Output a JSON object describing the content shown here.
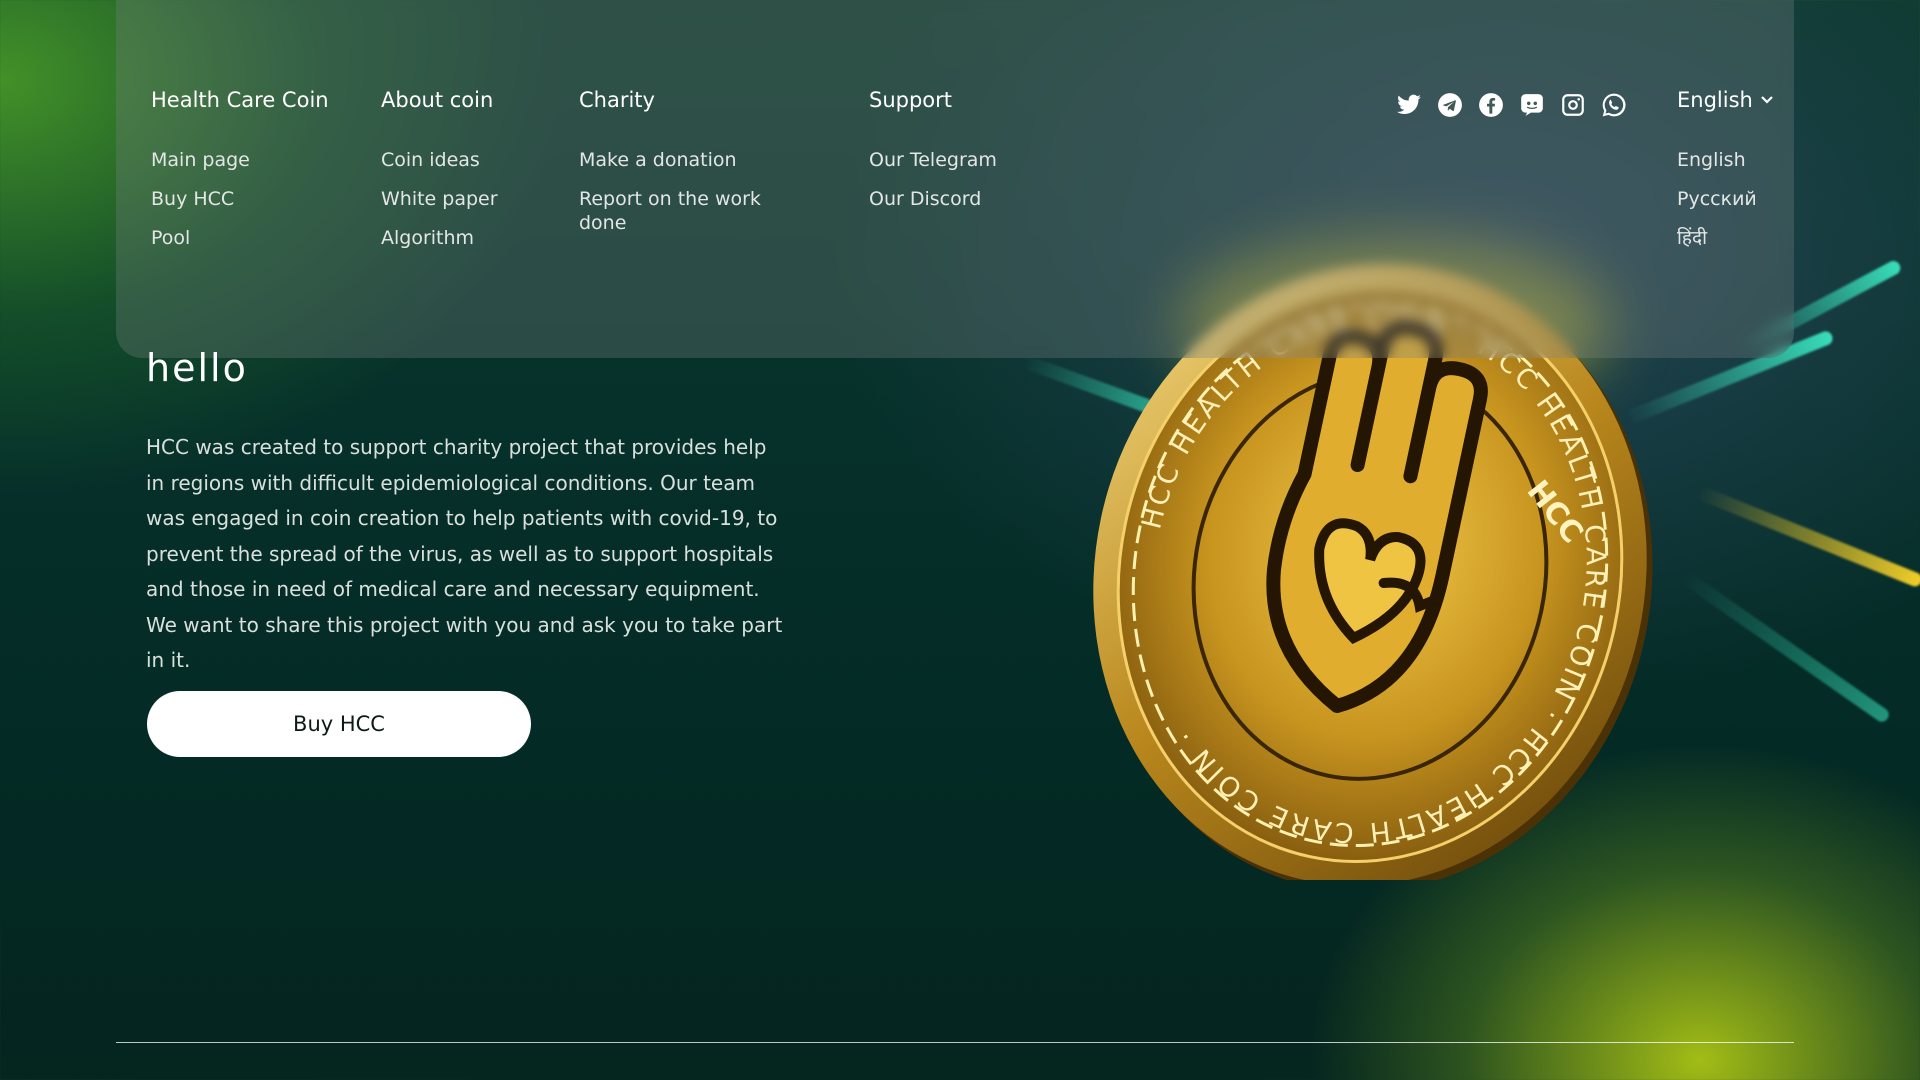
{
  "nav": {
    "columns": [
      {
        "title": "Health Care Coin",
        "links": [
          "Main page",
          "Buy HCC",
          "Pool"
        ]
      },
      {
        "title": "About coin",
        "links": [
          "Coin ideas",
          "White paper",
          "Algorithm"
        ]
      },
      {
        "title": "Charity",
        "links": [
          "Make a donation",
          "Report on the work done"
        ]
      },
      {
        "title": "Support",
        "links": [
          "Our Telegram",
          "Our Discord"
        ]
      }
    ],
    "socials": [
      "twitter-icon",
      "telegram-icon",
      "facebook-icon",
      "discord-icon",
      "instagram-icon",
      "whatsapp-icon"
    ],
    "language": {
      "current": "English",
      "options": [
        "English",
        "Русский",
        "हिंदी"
      ]
    }
  },
  "hero": {
    "heading": "hello",
    "description": "HCC was created to support charity project that provides help in regions with difficult epidemiological conditions. Our team was engaged in coin creation to help patients with covid-19, to prevent the spread of the virus, as well as to support hospitals and those in need of medical care and necessary equipment. We want to share this project with you and ask you to take part in it.",
    "buy_label": "Buy HCC"
  },
  "coin": {
    "ring_text": "HCC HEALTH CARE COIN · HCC HEALTH CARE COIN · HCC HEALTH CARE COIN ·",
    "center_text": "HCC"
  },
  "colors": {
    "accent_gold": "#d9a824",
    "teal": "#3de8c3",
    "button_bg": "#ffffff"
  }
}
